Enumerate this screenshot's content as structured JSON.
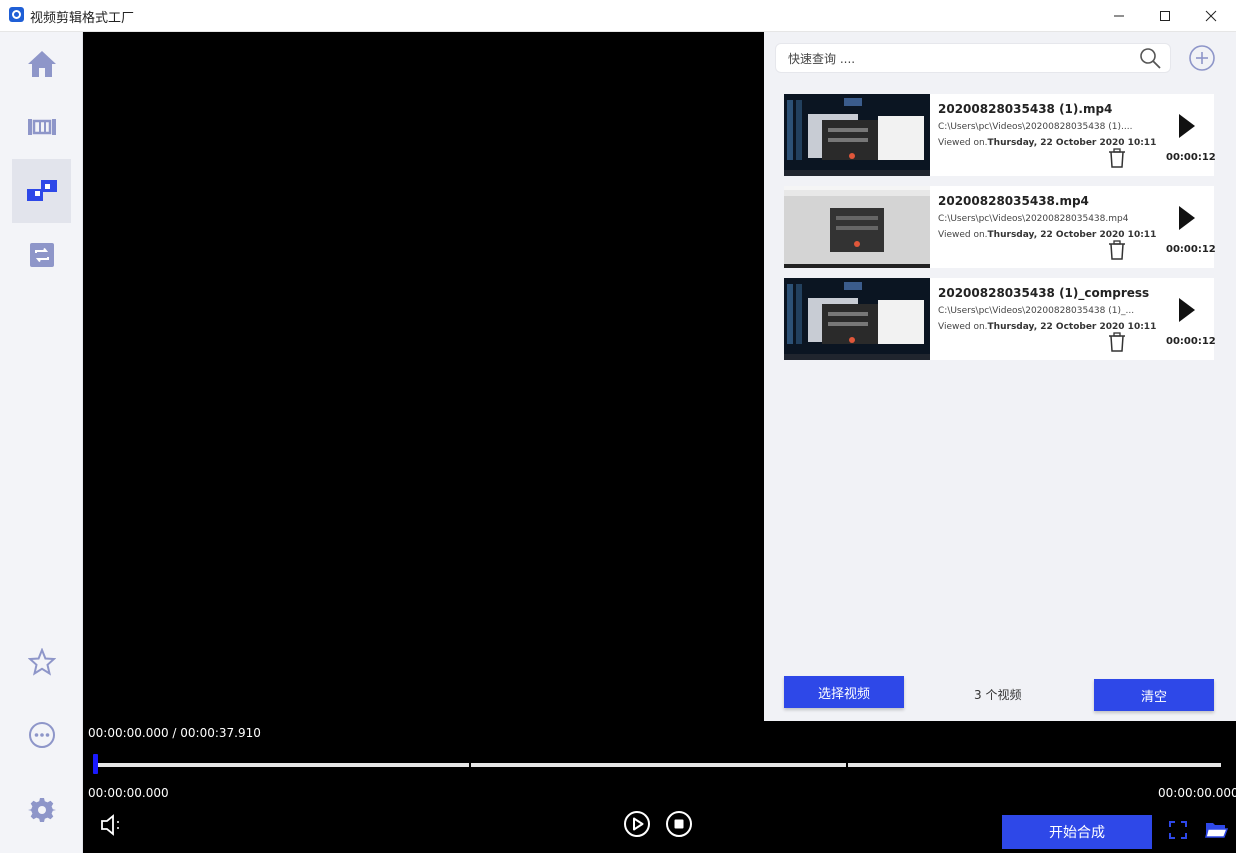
{
  "window": {
    "title": "视频剪辑格式工厂",
    "controls": [
      "minimize",
      "maximize",
      "close"
    ]
  },
  "sidebar": {
    "items": [
      {
        "id": "home",
        "icon": "home-icon",
        "active": false
      },
      {
        "id": "trim",
        "icon": "film-trim-icon",
        "active": false
      },
      {
        "id": "merge",
        "icon": "merge-blocks-icon",
        "active": true
      },
      {
        "id": "convert",
        "icon": "convert-icon",
        "active": false
      }
    ],
    "bottom_items": [
      {
        "id": "favorite",
        "icon": "star-icon"
      },
      {
        "id": "more",
        "icon": "more-icon"
      },
      {
        "id": "settings",
        "icon": "gear-icon"
      }
    ]
  },
  "player": {
    "time_display": "00:00:00.000 / 00:00:37.910",
    "start_time": "00:00:00.000",
    "end_time": "00:00:00.000",
    "merge_button": "开始合成",
    "accent_color": "#2e48e8"
  },
  "panel": {
    "search": {
      "placeholder": "快速查询 ...."
    },
    "videos": [
      {
        "title": "20200828035438 (1).mp4",
        "path": "C:\\Users\\pc\\Videos\\20200828035438 (1)....",
        "viewed_label": "Viewed on.",
        "viewed_date": "Thursday, 22 October 2020 10:11",
        "duration": "00:00:12",
        "thumb": "dark"
      },
      {
        "title": "20200828035438.mp4",
        "path": "C:\\Users\\pc\\Videos\\20200828035438.mp4",
        "viewed_label": "Viewed on.",
        "viewed_date": "Thursday, 22 October 2020 10:11",
        "duration": "00:00:12",
        "thumb": "light"
      },
      {
        "title": "20200828035438 (1)_compress",
        "path": "C:\\Users\\pc\\Videos\\20200828035438 (1)_...",
        "viewed_label": "Viewed on.",
        "viewed_date": "Thursday, 22 October 2020 10:11",
        "duration": "00:00:12",
        "thumb": "dark"
      }
    ],
    "select_button": "选择视频",
    "count_text": "3 个视频",
    "clear_button": "清空"
  }
}
